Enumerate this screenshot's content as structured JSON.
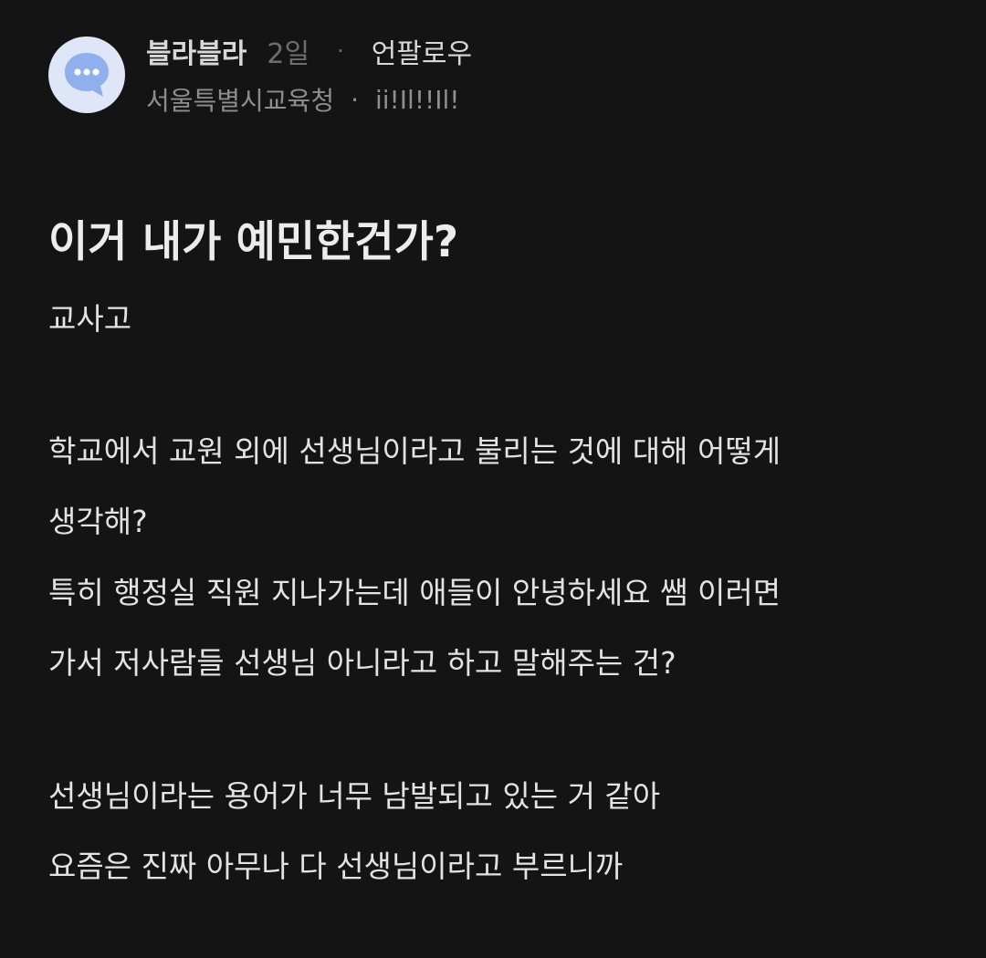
{
  "post": {
    "author": "블라블라",
    "time": "2일",
    "separator": "·",
    "follow_label": "언팔로우",
    "organization": "서울특별시교육청",
    "meta_separator": "·",
    "nickname": "ii!Il!!Il!",
    "avatar_icon": "speech-bubble-icon",
    "title": "이거 내가 예민한건가?",
    "body_lines": [
      "교사고",
      "학교에서 교원 외에 선생님이라고 불리는 것에 대해 어떻게",
      "생각해?",
      "특히 행정실 직원 지나가는데 애들이 안녕하세요 쌤 이러면",
      "가서 저사람들 선생님 아니라고 하고 말해주는 건?",
      "선생님이라는 용어가 너무 남발되고 있는 거 같아",
      "요즘은 진짜 아무나 다 선생님이라고 부르니까"
    ]
  },
  "colors": {
    "background": "#141414",
    "avatar_bg": "#dfe6f7",
    "avatar_icon": "#8fb0ec"
  }
}
